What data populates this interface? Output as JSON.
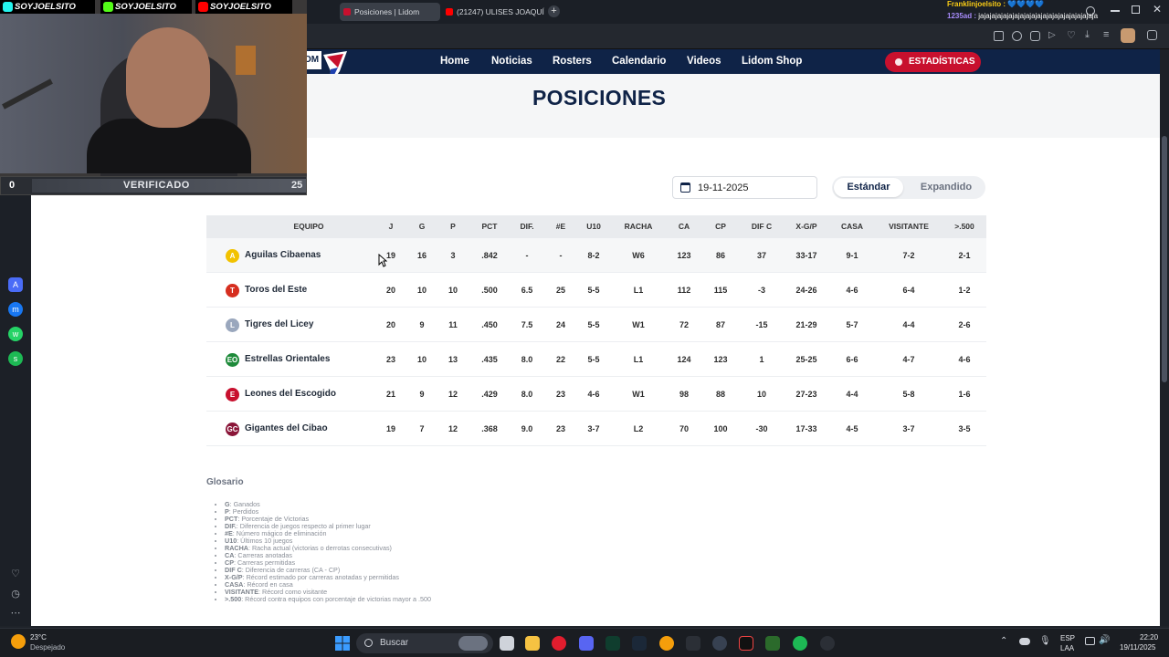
{
  "browser": {
    "tabs": [
      {
        "title": "Posiciones | Lidom",
        "active": true
      },
      {
        "title": "(21247) ULISES JOAQUÍN",
        "active": false
      }
    ],
    "new_tab_symbol": "+"
  },
  "webcam": {
    "brands": [
      "SOYJOELSITO",
      "SOYJOELSITO",
      "SOYJOELSITO"
    ],
    "bar": {
      "left_value": "0",
      "label": "VERIFICADO",
      "right_value": "25"
    }
  },
  "chat": {
    "line1_user": "Franklinjoelsito :",
    "line1_msg": "💙💙💙💙",
    "line2_user": "1235ad :",
    "line2_msg": "jajajajajajajajajajajajajajajajajajajajaja"
  },
  "site": {
    "logo_fragment": "OM",
    "nav": [
      "Home",
      "Noticias",
      "Rosters",
      "Calendario",
      "Videos",
      "Lidom Shop"
    ],
    "stats_button": "ESTADÍSTICAS",
    "page_title": "POSICIONES",
    "date": "19-11-2025",
    "toggle": {
      "standard": "Estándar",
      "expanded": "Expandido"
    }
  },
  "standings": {
    "columns": [
      "EQUIPO",
      "J",
      "G",
      "P",
      "PCT",
      "DIF.",
      "#E",
      "U10",
      "RACHA",
      "CA",
      "CP",
      "DIF C",
      "X-G/P",
      "CASA",
      "VISITANTE",
      ">.500"
    ],
    "rows": [
      {
        "team": "Aguilas Cibaenas",
        "logo": "A",
        "color": "#f2c200",
        "values": [
          "19",
          "16",
          "3",
          ".842",
          "-",
          "-",
          "8-2",
          "W6",
          "123",
          "86",
          "37",
          "33-17",
          "9-1",
          "7-2",
          "2-1"
        ]
      },
      {
        "team": "Toros del Este",
        "logo": "T",
        "color": "#d62e1f",
        "values": [
          "20",
          "10",
          "10",
          ".500",
          "6.5",
          "25",
          "5-5",
          "L1",
          "112",
          "115",
          "-3",
          "24-26",
          "4-6",
          "6-4",
          "1-2"
        ]
      },
      {
        "team": "Tigres del Licey",
        "logo": "L",
        "color": "#9aa7bd",
        "values": [
          "20",
          "9",
          "11",
          ".450",
          "7.5",
          "24",
          "5-5",
          "W1",
          "72",
          "87",
          "-15",
          "21-29",
          "5-7",
          "4-4",
          "2-6"
        ]
      },
      {
        "team": "Estrellas Orientales",
        "logo": "EO",
        "color": "#1e8a3a",
        "values": [
          "23",
          "10",
          "13",
          ".435",
          "8.0",
          "22",
          "5-5",
          "L1",
          "124",
          "123",
          "1",
          "25-25",
          "6-6",
          "4-7",
          "4-6"
        ]
      },
      {
        "team": "Leones del Escogido",
        "logo": "E",
        "color": "#c8102e",
        "values": [
          "21",
          "9",
          "12",
          ".429",
          "8.0",
          "23",
          "4-6",
          "W1",
          "98",
          "88",
          "10",
          "27-23",
          "4-4",
          "5-8",
          "1-6"
        ]
      },
      {
        "team": "Gigantes del Cibao",
        "logo": "GC",
        "color": "#8a1538",
        "values": [
          "19",
          "7",
          "12",
          ".368",
          "9.0",
          "23",
          "3-7",
          "L2",
          "70",
          "100",
          "-30",
          "17-33",
          "4-5",
          "3-7",
          "3-5"
        ]
      }
    ]
  },
  "glossary": {
    "title": "Glosario",
    "items": [
      {
        "term": "G",
        "desc": ": Ganados"
      },
      {
        "term": "P",
        "desc": ": Perdidos"
      },
      {
        "term": "PCT",
        "desc": ": Porcentaje de Victorias"
      },
      {
        "term": "DIF.",
        "desc": ": Diferencia de juegos respecto al primer lugar"
      },
      {
        "term": "#E",
        "desc": ": Número mágico de eliminación"
      },
      {
        "term": "U10",
        "desc": ": Últimos 10 juegos"
      },
      {
        "term": "RACHA",
        "desc": ": Racha actual (victorias o derrotas consecutivas)"
      },
      {
        "term": "CA",
        "desc": ": Carreras anotadas"
      },
      {
        "term": "CP",
        "desc": ": Carreras permitidas"
      },
      {
        "term": "DIF C",
        "desc": ": Diferencia de carreras (CA - CP)"
      },
      {
        "term": "X-G/P",
        "desc": ": Récord estimado por carreras anotadas y permitidas"
      },
      {
        "term": "CASA",
        "desc": ": Récord en casa"
      },
      {
        "term": "VISITANTE",
        "desc": ": Récord como visitante"
      },
      {
        "term": ">.500",
        "desc": ": Récord contra equipos con porcentaje de victorias mayor a .500"
      }
    ]
  },
  "taskbar": {
    "weather_temp": "23°C",
    "weather_desc": "Despejado",
    "search_placeholder": "Buscar",
    "lang": "ESP",
    "lang_sub": "LAA",
    "time": "22:20",
    "date": "19/11/2025"
  }
}
